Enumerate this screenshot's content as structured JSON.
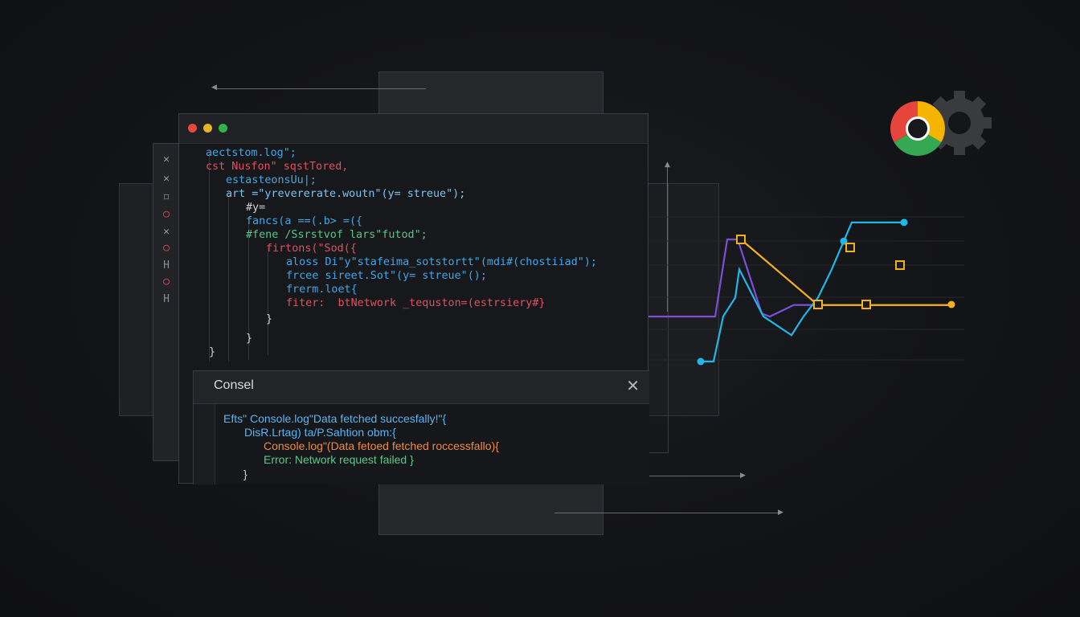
{
  "editor": {
    "window_dots": [
      "#e8483c",
      "#e5b323",
      "#2fb34a"
    ],
    "code_lines": [
      {
        "text": "aectstom.log\";",
        "color": "#3fa7e8"
      },
      {
        "text": "cst Nusfon\" sqstTored,",
        "color": "#e0505e"
      },
      {
        "text": "estasteonsUu|;",
        "color": "#3fa7e8"
      },
      {
        "text": "art =\"yrevererate.woutn\"(y= streue\");",
        "color": "#7cc3f0"
      },
      {
        "text": "#y=",
        "color": "#cfd0d2"
      },
      {
        "text": "fancs(a ==(.b> =({",
        "color": "#3fa7e8"
      },
      {
        "text": "#fene /Ssrstvof lars\"futod\";",
        "color": "#57c48a"
      },
      {
        "text": "firtons(\"Sod({",
        "color": "#e0505e"
      },
      {
        "text": "aloss Di\"y\"stafeima_sotstortt\"(mdi#(chostiiad\");",
        "color": "#3fa7e8"
      },
      {
        "text": "frcee sireet.Sot\"(y= streue\"();",
        "color": "#3fa7e8"
      },
      {
        "text": "frerm.loet{",
        "color": "#3fa7e8"
      },
      {
        "text": "fiter:  btNetwork _tequston=(estrsiery#}",
        "color": "#e0505e"
      },
      {
        "text": "}",
        "color": "#cfd0d2"
      },
      {
        "text": "}",
        "color": "#cfd0d2"
      },
      {
        "text": "}",
        "color": "#cfd0d2"
      }
    ]
  },
  "gutter_icons": [
    {
      "glyph": "✕",
      "name": "close-icon",
      "color": "#9a9ba0"
    },
    {
      "glyph": "✕",
      "name": "close-icon",
      "color": "#9a9ba0"
    },
    {
      "glyph": "⌑",
      "name": "bracket-icon",
      "color": "#8a8b90"
    },
    {
      "glyph": "○",
      "name": "error-circle-icon",
      "color": "#e0505e"
    },
    {
      "glyph": "✕",
      "name": "close-icon",
      "color": "#9a9ba0"
    },
    {
      "glyph": "○",
      "name": "error-circle-icon",
      "color": "#e0505e"
    },
    {
      "glyph": "H",
      "name": "heading-icon",
      "color": "#8a8b90"
    },
    {
      "glyph": "○",
      "name": "error-circle-icon",
      "color": "#e0505e"
    },
    {
      "glyph": "H",
      "name": "heading-icon",
      "color": "#8a8b90"
    }
  ],
  "console": {
    "title": "Consel",
    "close_icon": "✕",
    "lines": [
      {
        "text": "Efts\" Console.log\"Data fetched succesfally!\"{",
        "color": "#5ab4f0"
      },
      {
        "text": "DisR.Lrtag) ta/P.Sahtion obm:{",
        "color": "#5ab4f0"
      },
      {
        "text": "Console.log\"(Data fetoed fetched roccessfallo){",
        "color": "#f08a3c"
      },
      {
        "text": "Error: Network request failed }",
        "color": "#5cc98a"
      },
      {
        "text": "}",
        "color": "#cfd0d2"
      }
    ]
  },
  "browser_logo": {
    "icon": "chrome-logo-icon",
    "colors": [
      "#e5453c",
      "#f4b400",
      "#34a853",
      "#4f8ef7"
    ]
  },
  "settings_icon": {
    "icon": "gear-icon",
    "color": "#3a3b3f"
  },
  "chart_data": {
    "type": "line",
    "series": [
      {
        "color": "#7b4fd6",
        "values": [
          0.0,
          0.0,
          0.0,
          1.0,
          1.0,
          0.04,
          0.0,
          0.15,
          0.15,
          0.15,
          0.15,
          0.15,
          0.15
        ]
      },
      {
        "color": "#1fb8e8",
        "values": [
          -0.48,
          -0.48,
          0.0,
          0.2,
          0.5,
          0.0,
          -0.2,
          0.0,
          0.2,
          0.5,
          0.8,
          1.0,
          1.0
        ]
      },
      {
        "color": "#f2b01e",
        "values": [
          0.88,
          0.88,
          0.15,
          0.15,
          0.15,
          0.15,
          0.15,
          0.15
        ]
      }
    ],
    "grid": true
  }
}
